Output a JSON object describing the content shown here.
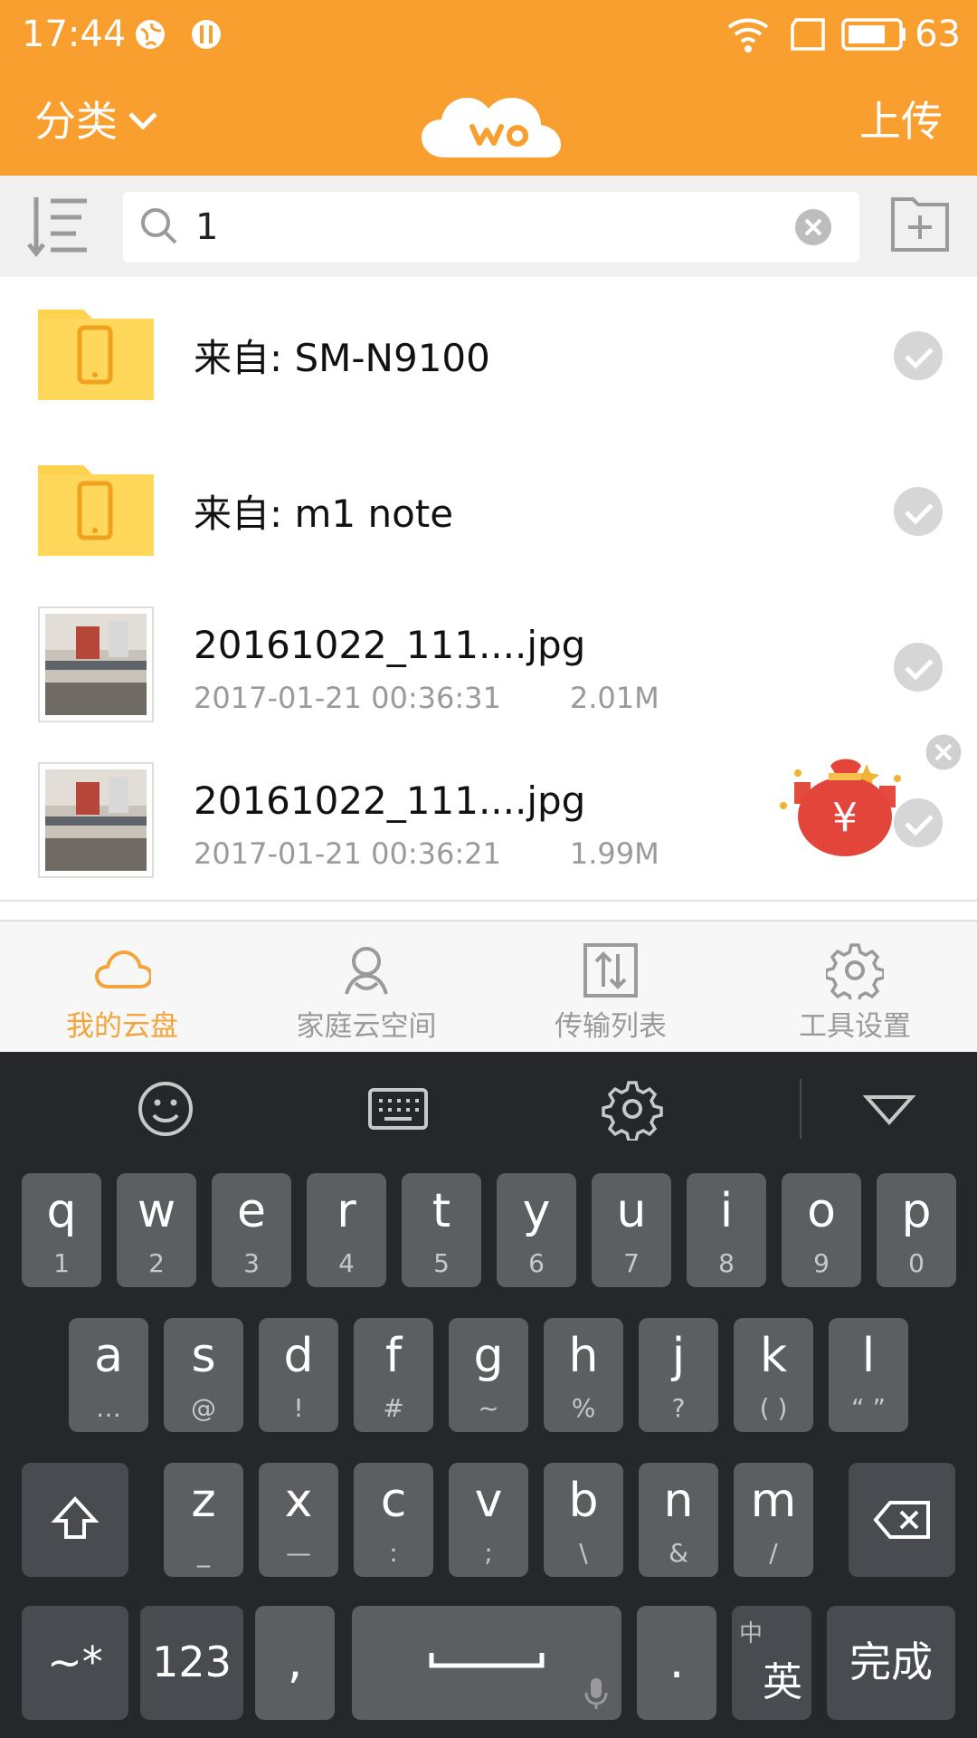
{
  "status_bar": {
    "time": "17:44",
    "battery": "63",
    "icons": [
      "browser-icon",
      "restaurant-icon",
      "wifi-icon",
      "tablet-icon",
      "battery-icon"
    ]
  },
  "header": {
    "category_label": "分类",
    "upload_label": "上传",
    "logo_icon": "wo-cloud-logo",
    "accent_color": "#f89f2f"
  },
  "search": {
    "value": "1",
    "placeholder": ""
  },
  "files": [
    {
      "title": "来自: SM-N9100",
      "type": "folder",
      "icon": "phone-folder-icon"
    },
    {
      "title": "来自: m1 note",
      "type": "folder",
      "icon": "phone-folder-icon"
    },
    {
      "title": "20161022_111....jpg",
      "date": "2017-01-21 00:36:31",
      "size": "2.01M",
      "type": "image"
    },
    {
      "title": "20161022_111....jpg",
      "date": "2017-01-21 00:36:21",
      "size": "1.99M",
      "type": "image"
    }
  ],
  "promo": {
    "icon": "red-envelope-bag-icon"
  },
  "tabs": [
    {
      "label": "我的云盘",
      "icon": "cloud-icon",
      "active": true
    },
    {
      "label": "家庭云空间",
      "icon": "family-icon",
      "active": false
    },
    {
      "label": "传输列表",
      "icon": "transfer-icon",
      "active": false
    },
    {
      "label": "工具设置",
      "icon": "gear-icon",
      "active": false
    }
  ],
  "keyboard": {
    "row1": [
      {
        "ch": "q",
        "sub": "1"
      },
      {
        "ch": "w",
        "sub": "2"
      },
      {
        "ch": "e",
        "sub": "3"
      },
      {
        "ch": "r",
        "sub": "4"
      },
      {
        "ch": "t",
        "sub": "5"
      },
      {
        "ch": "y",
        "sub": "6"
      },
      {
        "ch": "u",
        "sub": "7"
      },
      {
        "ch": "i",
        "sub": "8"
      },
      {
        "ch": "o",
        "sub": "9"
      },
      {
        "ch": "p",
        "sub": "0"
      }
    ],
    "row2": [
      {
        "ch": "a",
        "sub": "…"
      },
      {
        "ch": "s",
        "sub": "@"
      },
      {
        "ch": "d",
        "sub": "!"
      },
      {
        "ch": "f",
        "sub": "#"
      },
      {
        "ch": "g",
        "sub": "~"
      },
      {
        "ch": "h",
        "sub": "%"
      },
      {
        "ch": "j",
        "sub": "?"
      },
      {
        "ch": "k",
        "sub": "( )"
      },
      {
        "ch": "l",
        "sub": "“ ”"
      }
    ],
    "row3": [
      {
        "ch": "z",
        "sub": "_"
      },
      {
        "ch": "x",
        "sub": "—"
      },
      {
        "ch": "c",
        "sub": ":"
      },
      {
        "ch": "v",
        "sub": ";"
      },
      {
        "ch": "b",
        "sub": "\\"
      },
      {
        "ch": "n",
        "sub": "&"
      },
      {
        "ch": "m",
        "sub": "/"
      }
    ],
    "row4": {
      "symbols": "~*",
      "numbers": "123",
      "comma": ",",
      "period": ".",
      "lang_top": "中",
      "lang_bottom": "英",
      "done": "完成"
    }
  }
}
